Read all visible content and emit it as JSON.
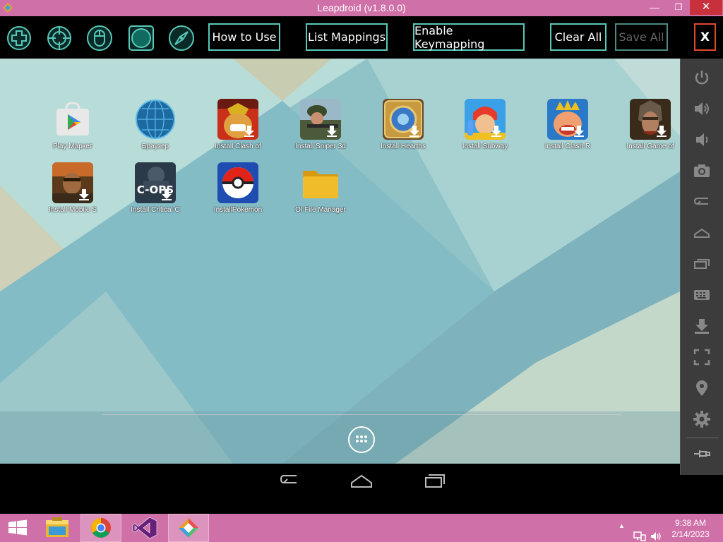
{
  "window": {
    "title": "Leapdroid (v1.8.0.0)",
    "minimize_glyph": "—",
    "restore_glyph": "❐",
    "close_glyph": "✕"
  },
  "toolbar": {
    "tools": [
      {
        "name": "dpad-tool",
        "icon": "dpad-icon"
      },
      {
        "name": "crosshair-tool",
        "icon": "crosshair-icon"
      },
      {
        "name": "mouse-tool",
        "icon": "mouse-icon"
      },
      {
        "name": "tap-tool",
        "icon": "circle-tap-icon"
      },
      {
        "name": "compass-tool",
        "icon": "compass-icon"
      }
    ],
    "how_to_use": "How to Use",
    "list_mappings": "List Mappings",
    "enable_keymapping": "Enable Keymapping",
    "clear_all": "Clear All",
    "save_all": "Save All",
    "close": "X"
  },
  "desktop": {
    "apps": [
      {
        "label": "Play Маркет",
        "icon": "play-store-icon"
      },
      {
        "label": "Браузер",
        "icon": "browser-globe-icon"
      },
      {
        "label": "Install Clash of",
        "icon": "clash-of-clans-icon"
      },
      {
        "label": "Install Sniper 3d",
        "icon": "sniper-3d-icon"
      },
      {
        "label": "Install Hearths",
        "icon": "hearthstone-icon"
      },
      {
        "label": "Install Subway",
        "icon": "subway-surfers-icon"
      },
      {
        "label": "Install Clash R",
        "icon": "clash-royale-icon"
      },
      {
        "label": "Install Game of",
        "icon": "game-of-war-icon"
      },
      {
        "label": "Install Mobile S",
        "icon": "mobile-strike-icon"
      },
      {
        "label": "Install Critical C",
        "icon": "critical-ops-icon"
      },
      {
        "label": "InstallPokemon",
        "icon": "pokeball-icon"
      },
      {
        "label": "OI File Manager",
        "icon": "folder-icon"
      }
    ],
    "cops_text": "C-OPS",
    "app_drawer_icon": "app-drawer-icon"
  },
  "sidebar": {
    "buttons": [
      "power-icon",
      "volume-up-icon",
      "volume-down-icon",
      "camera-icon",
      "back-icon",
      "home-icon",
      "recent-apps-icon",
      "keyboard-icon",
      "download-icon",
      "fullscreen-icon",
      "location-icon",
      "settings-icon",
      "pin-icon"
    ]
  },
  "taskbar": {
    "items": [
      "windows-start-icon",
      "file-explorer-icon",
      "chrome-icon",
      "visual-studio-icon",
      "leapdroid-icon"
    ],
    "tray_arrow": "▲",
    "time": "9:38 AM",
    "date": "2/14/2023"
  },
  "colors": {
    "titlebar": "#d070a8",
    "toolbar_border": "#58c8b8",
    "close_red": "#c8313c",
    "sidebar": "#3c3c3c"
  }
}
